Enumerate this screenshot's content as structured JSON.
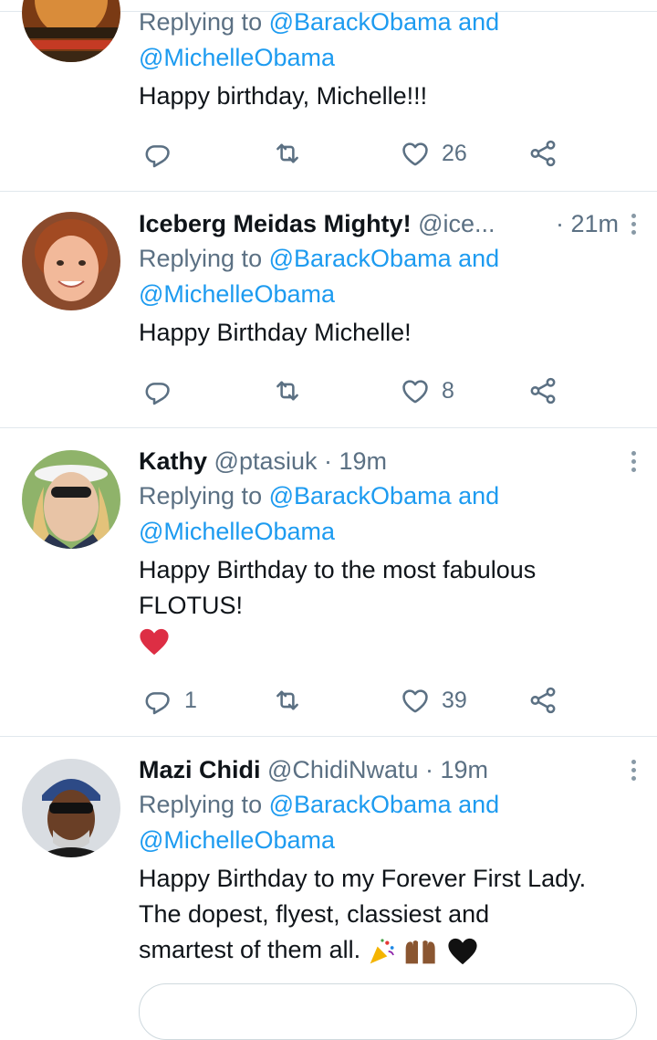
{
  "reply_prefix": "Replying to",
  "mention_and": "and",
  "mention_one": "@BarackObama",
  "mention_two": "@MichelleObama",
  "tweets": [
    {
      "text": "Happy birthday, Michelle!!!",
      "reply_count": "",
      "like_count": "26"
    },
    {
      "name": "Iceberg Meidas Mighty!",
      "handle": "@ice...",
      "time": "· 21m",
      "text": "Happy Birthday Michelle!",
      "reply_count": "",
      "like_count": "8"
    },
    {
      "name": "Kathy",
      "handle": "@ptasiuk",
      "time": "· 19m",
      "text_line1": "Happy Birthday to the most fabulous",
      "text_line2": "FLOTUS!",
      "reply_count": "1",
      "like_count": "39"
    },
    {
      "name": "Mazi Chidi",
      "handle": "@ChidiNwatu",
      "time": "· 19m",
      "text_line1": "Happy Birthday to my Forever First Lady.",
      "text_line2": "The dopest, flyest, classiest and",
      "text_line3": "smartest of them all."
    }
  ],
  "icons": [
    "reply-icon",
    "retweet-icon",
    "like-icon",
    "share-icon",
    "more-icon",
    "red-heart-emoji",
    "party-popper-emoji",
    "raised-hands-emoji",
    "black-heart-emoji"
  ],
  "colors": {
    "link": "#1d9bf0",
    "secondary": "#5b7083",
    "divider": "#e1e8ed",
    "heart": "#e0245e"
  }
}
